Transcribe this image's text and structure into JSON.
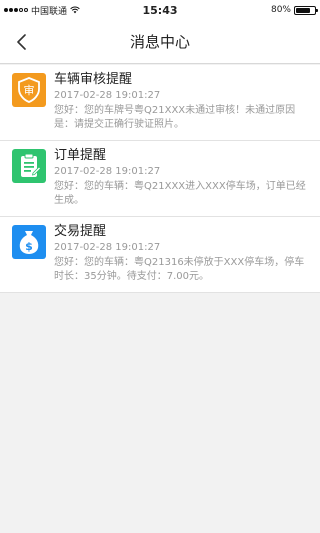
{
  "status_bar": {
    "carrier": "中国联通",
    "time": "15:43",
    "battery": "80%",
    "battery_level": 0.8
  },
  "nav": {
    "title": "消息中心",
    "back_icon": "chevron-left-icon"
  },
  "messages": [
    {
      "title": "车辆审核提醒",
      "time": "2017-02-28 19:01:27",
      "body": "您好：您的车牌号粤Q21XXX未通过审核！未通过原因是：请提交正确行驶证照片。",
      "icon": "audit-shield-icon",
      "icon_glyph": "审",
      "color": "#f39a1e"
    },
    {
      "title": "订单提醒",
      "time": "2017-02-28 19:01:27",
      "body": "您好：您的车辆：粤Q21XXX进入XXX停车场，订单已经生成。",
      "icon": "order-clipboard-icon",
      "color": "#2fc46f"
    },
    {
      "title": "交易提醒",
      "time": "2017-02-28 19:01:27",
      "body": "您好：您的车辆：粤Q21316未停放于XXX停车场，停车时长：35分钟。待支付：7.00元。",
      "icon": "money-bag-icon",
      "icon_glyph": "$",
      "color": "#1e8ef0"
    }
  ]
}
